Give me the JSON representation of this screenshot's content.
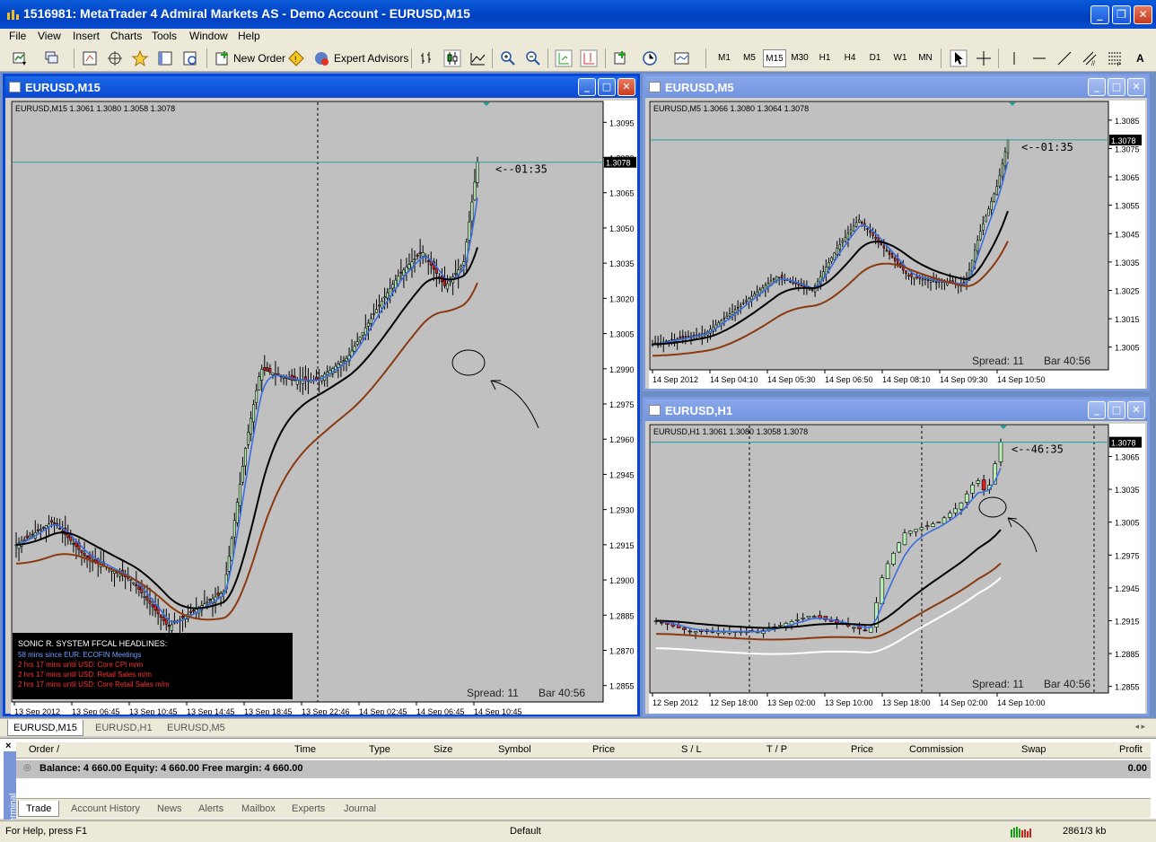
{
  "app": {
    "title": "1516981: MetaTrader 4 Admiral Markets AS - Demo Account - EURUSD,M15"
  },
  "menu": [
    "File",
    "View",
    "Insert",
    "Charts",
    "Tools",
    "Window",
    "Help"
  ],
  "toolbar": {
    "new_order": "New Order",
    "expert_advisors": "Expert Advisors",
    "timeframes": [
      "M1",
      "M5",
      "M15",
      "M30",
      "H1",
      "H4",
      "D1",
      "W1",
      "MN"
    ],
    "active_timeframe": "M15"
  },
  "charts": {
    "m15": {
      "title": "EURUSD,M15",
      "info": "EURUSD,M15  1.3061 1.3080 1.3058 1.3078",
      "countdown": "<--01:35",
      "spread": "Spread: 11",
      "bar": "Bar  40:56",
      "current_price": "1.3078",
      "price_ticks": [
        "1.3095",
        "1.3080",
        "1.3065",
        "1.3050",
        "1.3035",
        "1.3020",
        "1.3005",
        "1.2990",
        "1.2975",
        "1.2960",
        "1.2945",
        "1.2930",
        "1.2915",
        "1.2900",
        "1.2885",
        "1.2870",
        "1.2855"
      ],
      "time_ticks": [
        "13 Sep 2012",
        "13 Sep 06:45",
        "13 Sep 10:45",
        "13 Sep 14:45",
        "13 Sep 18:45",
        "13 Sep 22:46",
        "14 Sep 02:45",
        "14 Sep 06:45",
        "14 Sep 10:45"
      ],
      "news": {
        "title": "SONIC R. SYSTEM  FFCAL HEADLINES:",
        "lines": [
          {
            "text": "58 mins since EUR: ECOFIN Meetings",
            "color": "#6fa0ff"
          },
          {
            "text": "2 hrs 17 mins until USD: Core CPI m/m",
            "color": "#ff3030"
          },
          {
            "text": "2 hrs 17 mins until USD: Retail Sales m/m",
            "color": "#ff3030"
          },
          {
            "text": "2 hrs 17 mins until USD: Core Retail Sales m/m",
            "color": "#ff3030"
          }
        ]
      }
    },
    "m5": {
      "title": "EURUSD,M5",
      "info": "EURUSD,M5  1.3066 1.3080 1.3064 1.3078",
      "countdown": "<--01:35",
      "spread": "Spread: 11",
      "bar": "Bar  40:56",
      "current_price": "1.3078",
      "price_ticks": [
        "1.3085",
        "1.3075",
        "1.3065",
        "1.3055",
        "1.3045",
        "1.3035",
        "1.3025",
        "1.3015",
        "1.3005"
      ],
      "time_ticks": [
        "14 Sep 2012",
        "14 Sep 04:10",
        "14 Sep 05:30",
        "14 Sep 06:50",
        "14 Sep 08:10",
        "14 Sep 09:30",
        "14 Sep 10:50"
      ]
    },
    "h1": {
      "title": "EURUSD,H1",
      "info": "EURUSD,H1  1.3061 1.3080 1.3058 1.3078",
      "countdown": "<--46:35",
      "spread": "Spread: 11",
      "bar": "Bar  40:56",
      "current_price": "1.3078",
      "price_ticks": [
        "1.3065",
        "1.3035",
        "1.3005",
        "1.2975",
        "1.2945",
        "1.2915",
        "1.2885",
        "1.2855"
      ],
      "time_ticks": [
        "12 Sep 2012",
        "12 Sep 18:00",
        "13 Sep 02:00",
        "13 Sep 10:00",
        "13 Sep 18:00",
        "14 Sep 02:00",
        "14 Sep 10:00"
      ]
    }
  },
  "chart_tabs": [
    "EURUSD,M15",
    "EURUSD,H1",
    "EURUSD,M5"
  ],
  "terminal": {
    "side_label": "Terminal",
    "columns": [
      "Order  /",
      "Time",
      "Type",
      "Size",
      "Symbol",
      "Price",
      "S / L",
      "T / P",
      "Price",
      "Commission",
      "Swap",
      "Profit"
    ],
    "balance_text": "Balance: 4 660.00  Equity: 4 660.00  Free margin: 4 660.00",
    "profit": "0.00",
    "tabs": [
      "Trade",
      "Account History",
      "News",
      "Alerts",
      "Mailbox",
      "Experts",
      "Journal"
    ]
  },
  "status": {
    "help": "For Help, press F1",
    "profile": "Default",
    "traffic": "2861/3 kb"
  },
  "colors": {
    "chart_bg": "#c0c0c0",
    "bull": "#b8f0b8",
    "bear": "#e02020",
    "ma_fast": "#3a6ee0",
    "ma_mid": "#000000",
    "ma_slow": "#8b3a10",
    "ma_h1": "#ffffff",
    "price_line": "#20a0a0"
  }
}
